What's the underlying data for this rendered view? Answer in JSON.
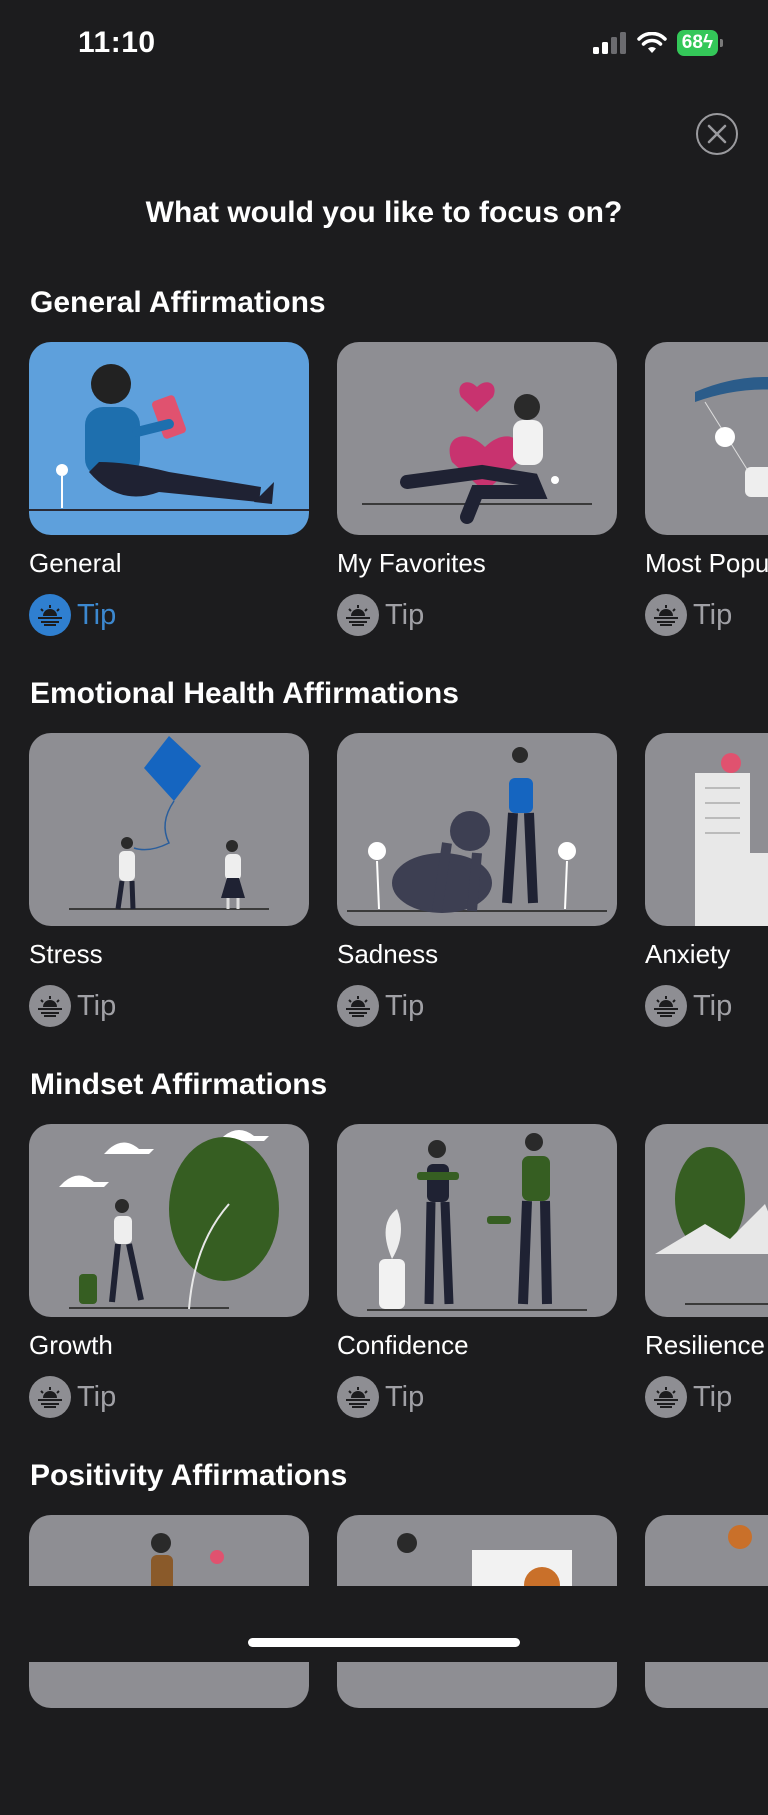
{
  "status_bar": {
    "time": "11:10",
    "battery": "68"
  },
  "header": {
    "title": "What would you like to focus on?"
  },
  "sections": [
    {
      "title": "General Affirmations",
      "cards": [
        {
          "label": "General",
          "tip": "Tip",
          "active": true,
          "bg": "#5ea0dc"
        },
        {
          "label": "My Favorites",
          "tip": "Tip",
          "active": false,
          "bg": "#8e8e93"
        },
        {
          "label": "Most Popular",
          "tip": "Tip",
          "active": false,
          "bg": "#8e8e93"
        }
      ]
    },
    {
      "title": "Emotional Health Affirmations",
      "cards": [
        {
          "label": "Stress",
          "tip": "Tip"
        },
        {
          "label": "Sadness",
          "tip": "Tip"
        },
        {
          "label": "Anxiety",
          "tip": "Tip"
        }
      ]
    },
    {
      "title": "Mindset Affirmations",
      "cards": [
        {
          "label": "Growth",
          "tip": "Tip"
        },
        {
          "label": "Confidence",
          "tip": "Tip"
        },
        {
          "label": "Resilience",
          "tip": "Tip"
        }
      ]
    },
    {
      "title": "Positivity Affirmations",
      "cards": []
    }
  ],
  "colors": {
    "background": "#1c1c1e",
    "card": "#8e8e93",
    "accent": "#2f7fd0",
    "battery": "#34c759"
  }
}
